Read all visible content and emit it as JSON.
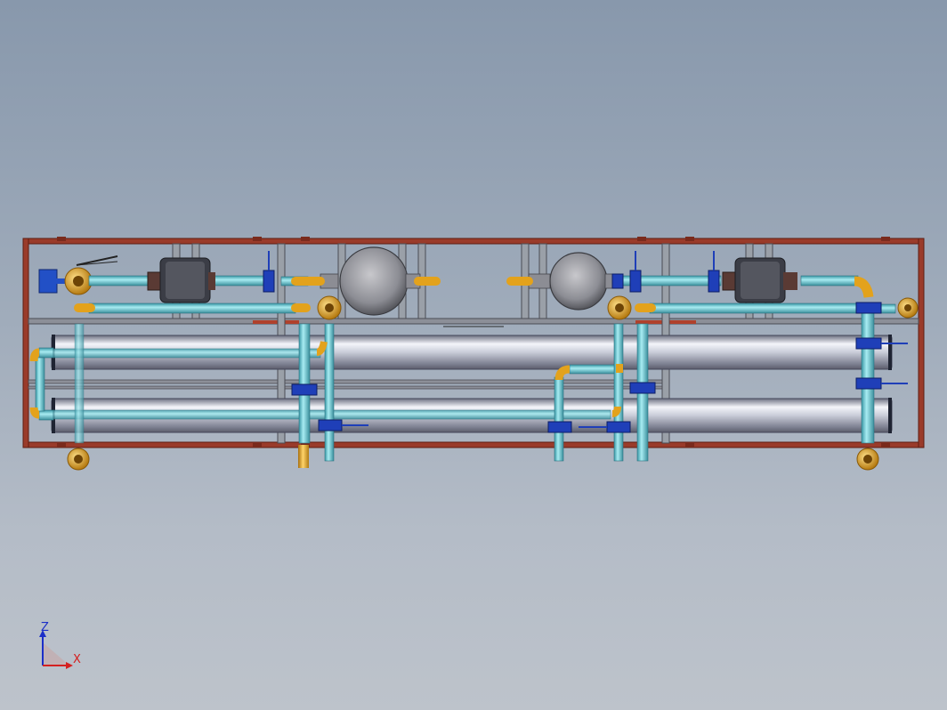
{
  "window": {
    "title": ""
  },
  "view": {
    "background_top": "#8898ac",
    "background_bottom": "#bdc3cb"
  },
  "model": {
    "frame_color": "#9a3b2a",
    "pipe_color": "#6ec7d2",
    "fitting_color": "#e3a21c",
    "valve_color": "#1f3fb8",
    "vessel_color": "#c9ccd8",
    "elements": {
      "pressure_vessels": 2,
      "filter_housings": 2,
      "cartridge_filters": 2,
      "pumps": 1
    }
  },
  "triad": {
    "z_label": "Z",
    "x_label": "X",
    "z_color": "#1c2fc8",
    "x_color": "#d42020"
  }
}
